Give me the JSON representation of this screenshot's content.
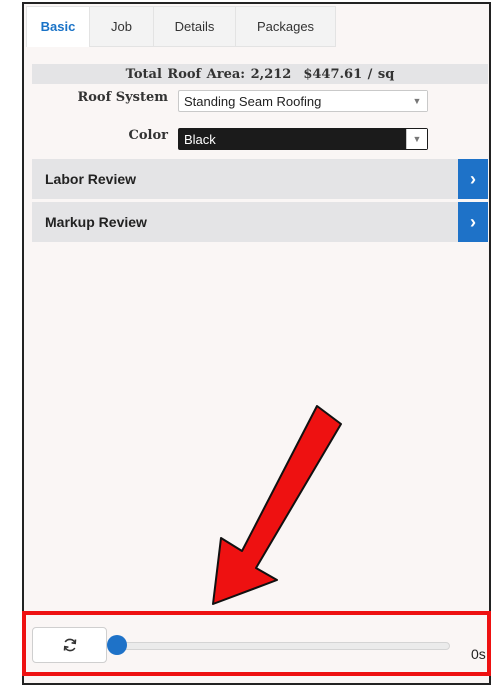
{
  "tabs": [
    {
      "label": "Basic",
      "active": true
    },
    {
      "label": "Job",
      "active": false
    },
    {
      "label": "Details",
      "active": false
    },
    {
      "label": "Packages",
      "active": false
    }
  ],
  "summary": {
    "area_text": "Total Roof Area: 2,212",
    "price_text": "$447.61 / sq"
  },
  "form": {
    "roof_system_label": "Roof System",
    "roof_system_value": "Standing Seam Roofing",
    "color_label": "Color",
    "color_value": "Black"
  },
  "accordions": [
    {
      "label": "Labor Review"
    },
    {
      "label": "Markup Review"
    }
  ],
  "player": {
    "refresh_icon": "refresh-icon",
    "time": "0s",
    "slider_progress": 0
  },
  "colors": {
    "accent": "#1e72c8",
    "annotation": "#ee1111"
  }
}
